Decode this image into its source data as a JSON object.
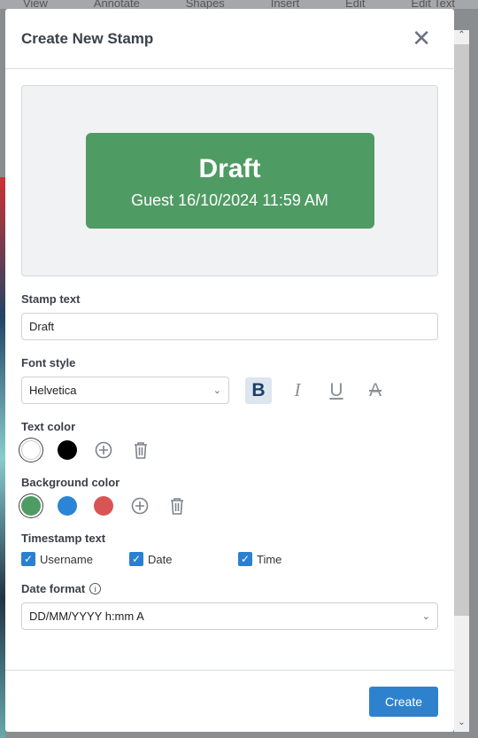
{
  "background_menu": [
    "View",
    "Annotate",
    "Shapes",
    "Insert",
    "Edit",
    "Edit Text"
  ],
  "dialog": {
    "title": "Create New Stamp",
    "close_icon": "close-icon"
  },
  "preview": {
    "text": "Draft",
    "subtext": "Guest 16/10/2024 11:59 AM",
    "background": "#4f9b64",
    "text_color": "#ffffff"
  },
  "stamp_text": {
    "label": "Stamp text",
    "value": "Draft"
  },
  "font_style": {
    "label": "Font style",
    "font": "Helvetica",
    "bold": true,
    "italic": false,
    "underline": false,
    "strikethrough": false
  },
  "text_color": {
    "label": "Text color",
    "colors": [
      "#ffffff",
      "#000000"
    ],
    "selected": "#ffffff"
  },
  "background_color": {
    "label": "Background color",
    "colors": [
      "#4f9b64",
      "#2b84d6",
      "#d95555"
    ],
    "selected": "#4f9b64"
  },
  "timestamp": {
    "label": "Timestamp text",
    "options": [
      {
        "label": "Username",
        "checked": true
      },
      {
        "label": "Date",
        "checked": true
      },
      {
        "label": "Time",
        "checked": true
      }
    ]
  },
  "date_format": {
    "label": "Date format",
    "value": "DD/MM/YYYY h:mm A"
  },
  "footer": {
    "create_label": "Create"
  }
}
